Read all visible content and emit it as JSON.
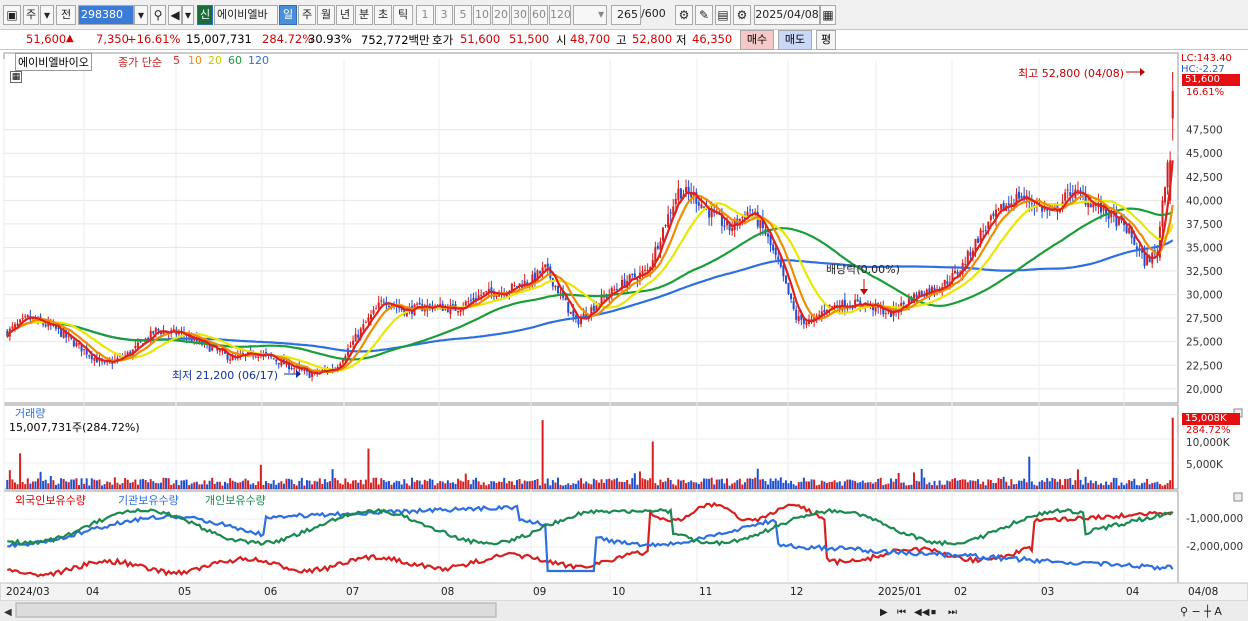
{
  "toolbar": {
    "menu_btn": "주",
    "jeon": "전",
    "code": "298380",
    "signal": "신",
    "name": "에이비엘바",
    "periods": [
      "일",
      "주",
      "월",
      "년",
      "분",
      "초",
      "틱"
    ],
    "intervals": [
      "1",
      "3",
      "5",
      "10",
      "20",
      "30",
      "60",
      "120"
    ],
    "count": "265",
    "count_max": "/600",
    "date": "2025/04/08"
  },
  "quote": {
    "price": "51,600",
    "up_arrow": "▲",
    "change": "7,350",
    "change_pct": "+16.61%",
    "volume": "15,007,731",
    "vol_ratio": "284.72%",
    "turnover": "30.93%",
    "amount": "752,772백만",
    "hoga_label": "호가",
    "ask": "51,600",
    "bid": "51,500",
    "open_label": "시",
    "open": "48,700",
    "high_label": "고",
    "high": "52,800",
    "low_label": "저",
    "low": "46,350",
    "buy": "매수",
    "sell": "매도",
    "pyeong": "평"
  },
  "legend": {
    "stock_name": "에이비엘바이오",
    "ma_label": "종가 단순",
    "ma_periods": [
      "5",
      "10",
      "20",
      "60",
      "120"
    ],
    "ma_colors": [
      "#e21f1f",
      "#f08c00",
      "#e8e800",
      "#1a9e3a",
      "#2e6fe0"
    ],
    "lc": "LC:143.40",
    "hc": "HC:-2.27",
    "cur_price": "51,600",
    "cur_pct": "16.61%",
    "high_note": "최고 52,800 (04/08)",
    "low_note": "최저 21,200 (06/17)",
    "dividend_note": "배당락(0.00%)"
  },
  "volume": {
    "title": "거래량",
    "value": "15,007,731주(284.72%)",
    "last": "15,008K",
    "last_pct": "284.72%",
    "ticks": [
      "10,000K",
      "5,000K"
    ]
  },
  "holdings": {
    "foreign": "외국인보유수량",
    "inst": "기관보유수량",
    "indiv": "개인보유수량",
    "ticks": [
      "-1,000,000",
      "-2,000,000"
    ]
  },
  "xaxis": {
    "labels": [
      "2024/03",
      "04",
      "05",
      "06",
      "07",
      "08",
      "09",
      "10",
      "11",
      "12",
      "2025/01",
      "02",
      "03",
      "04"
    ],
    "right_label": "04/08"
  },
  "chart_data": {
    "type": "candlestick",
    "ylim": [
      18500,
      55000
    ],
    "y_ticks": [
      20000,
      22500,
      25000,
      27500,
      30000,
      32500,
      35000,
      37500,
      40000,
      42500,
      45000,
      47500
    ],
    "close_keypoints": [
      [
        0,
        26000
      ],
      [
        8,
        27500
      ],
      [
        18,
        26500
      ],
      [
        28,
        24500
      ],
      [
        38,
        22500
      ],
      [
        48,
        23800
      ],
      [
        58,
        26200
      ],
      [
        68,
        25800
      ],
      [
        78,
        24500
      ],
      [
        88,
        23200
      ],
      [
        98,
        23800
      ],
      [
        108,
        22700
      ],
      [
        118,
        21500
      ],
      [
        128,
        22200
      ],
      [
        140,
        27000
      ],
      [
        147,
        29500
      ],
      [
        155,
        28300
      ],
      [
        165,
        28800
      ],
      [
        175,
        28500
      ],
      [
        185,
        30000
      ],
      [
        195,
        30500
      ],
      [
        205,
        31600
      ],
      [
        210,
        32800
      ],
      [
        217,
        29500
      ],
      [
        222,
        27000
      ],
      [
        232,
        29500
      ],
      [
        242,
        31500
      ],
      [
        250,
        32500
      ],
      [
        256,
        37000
      ],
      [
        262,
        41000
      ],
      [
        268,
        40500
      ],
      [
        275,
        38500
      ],
      [
        282,
        37000
      ],
      [
        290,
        39000
      ],
      [
        296,
        36500
      ],
      [
        302,
        32500
      ],
      [
        308,
        27500
      ],
      [
        314,
        27000
      ],
      [
        320,
        28700
      ],
      [
        328,
        29000
      ],
      [
        335,
        29000
      ],
      [
        345,
        28000
      ],
      [
        355,
        30000
      ],
      [
        365,
        31000
      ],
      [
        372,
        32600
      ],
      [
        380,
        36500
      ],
      [
        388,
        39000
      ],
      [
        395,
        40500
      ],
      [
        402,
        39500
      ],
      [
        408,
        38500
      ],
      [
        415,
        41000
      ],
      [
        422,
        40000
      ],
      [
        430,
        38500
      ],
      [
        437,
        37000
      ],
      [
        444,
        33500
      ],
      [
        449,
        34500
      ],
      [
        451,
        40000
      ],
      [
        453,
        44250
      ],
      [
        455,
        51600
      ]
    ],
    "volume_spikes": {
      "5": 7500,
      "141": 8500,
      "209": 14500,
      "252": 10000,
      "399": 6800,
      "455": 15008
    },
    "high_point": {
      "x": 455,
      "price": 52800,
      "label_date": "04/08"
    },
    "low_point": {
      "x": 118,
      "price": 21200,
      "label_date": "06/17"
    }
  }
}
